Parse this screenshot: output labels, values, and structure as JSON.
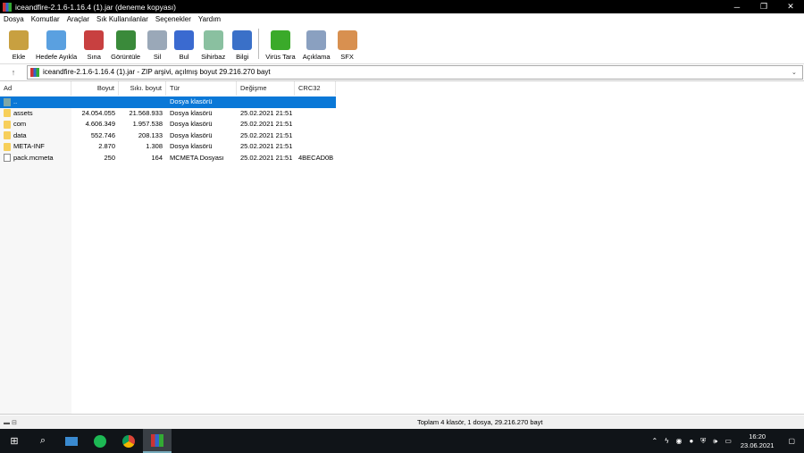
{
  "window": {
    "title": "iceandfire-2.1.6-1.16.4 (1).jar (deneme kopyası)",
    "minimize": "─",
    "restore": "❐",
    "close": "✕"
  },
  "menu": [
    "Dosya",
    "Komutlar",
    "Araçlar",
    "Sık Kullanılanlar",
    "Seçenekler",
    "Yardım"
  ],
  "toolbar": [
    {
      "label": "Ekle",
      "color": "#c8a040"
    },
    {
      "label": "Hedefe Ayıkla",
      "color": "#5aa0e0"
    },
    {
      "label": "Sına",
      "color": "#c84040"
    },
    {
      "label": "Görüntüle",
      "color": "#3a8a3a"
    },
    {
      "label": "Sil",
      "color": "#9aa8b8"
    },
    {
      "label": "Bul",
      "color": "#3a6ad0"
    },
    {
      "label": "Sihirbaz",
      "color": "#8ac0a0"
    },
    {
      "label": "Bilgi",
      "color": "#3a70c8"
    },
    {
      "label": "Virüs Tara",
      "color": "#3aaa2a"
    },
    {
      "label": "Açıklama",
      "color": "#8aa0c0"
    },
    {
      "label": "SFX",
      "color": "#d89050"
    }
  ],
  "address": {
    "up": "↑",
    "value": "iceandfire-2.1.6-1.16.4 (1).jar - ZIP arşivi, açılmış boyut 29.216.270 bayt",
    "dropdown": "⌄"
  },
  "columns": [
    "Ad",
    "Boyut",
    "Sıkı. boyut",
    "Tür",
    "Değişme",
    "CRC32"
  ],
  "rows": [
    {
      "name": "..",
      "size": "",
      "packed": "",
      "type": "Dosya klasörü",
      "modified": "",
      "crc": "",
      "kind": "up"
    },
    {
      "name": "assets",
      "size": "24.054.055",
      "packed": "21.568.933",
      "type": "Dosya klasörü",
      "modified": "25.02.2021 21:51",
      "crc": "",
      "kind": "folder"
    },
    {
      "name": "com",
      "size": "4.606.349",
      "packed": "1.957.538",
      "type": "Dosya klasörü",
      "modified": "25.02.2021 21:51",
      "crc": "",
      "kind": "folder"
    },
    {
      "name": "data",
      "size": "552.746",
      "packed": "208.133",
      "type": "Dosya klasörü",
      "modified": "25.02.2021 21:51",
      "crc": "",
      "kind": "folder"
    },
    {
      "name": "META-INF",
      "size": "2.870",
      "packed": "1.308",
      "type": "Dosya klasörü",
      "modified": "25.02.2021 21:51",
      "crc": "",
      "kind": "folder"
    },
    {
      "name": "pack.mcmeta",
      "size": "250",
      "packed": "164",
      "type": "MCMETA Dosyası",
      "modified": "25.02.2021 21:51",
      "crc": "4BECAD0B",
      "kind": "file"
    }
  ],
  "status": {
    "icons": "▬ ⊟",
    "text": "Toplam 4 klasör, 1 dosya, 29.216.270 bayt"
  },
  "taskbar": {
    "clock_time": "16:20",
    "clock_date": "23.06.2021"
  }
}
